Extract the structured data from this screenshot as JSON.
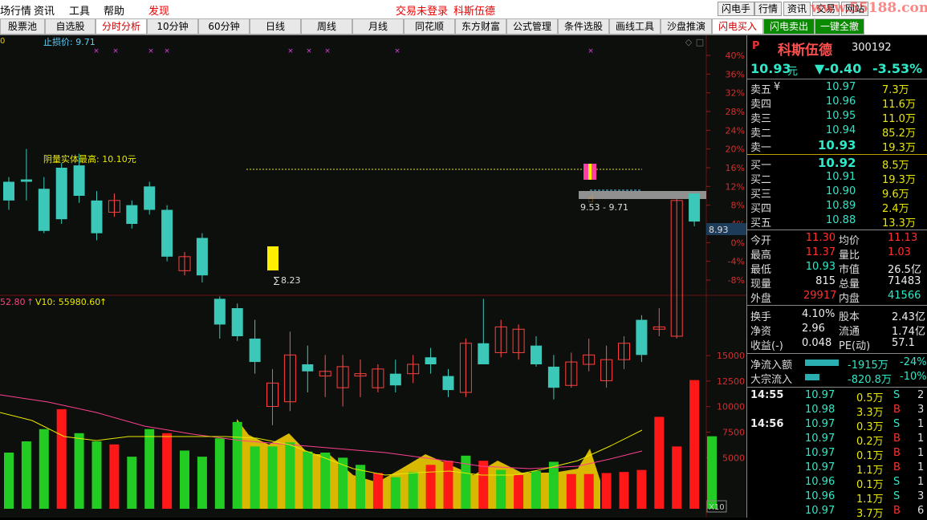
{
  "menu": {
    "items": [
      "场行情",
      "资讯",
      "工具",
      "帮助"
    ],
    "discover": "发现",
    "trade_status": "交易未登录",
    "stock_title": "科斯伍德",
    "right_buttons": [
      "闪电手",
      "行情",
      "资讯",
      "交易",
      "网站"
    ],
    "watermark": "www.55188.com"
  },
  "tabs": [
    {
      "label": "股票池",
      "state": "normal"
    },
    {
      "label": "自选股",
      "state": "normal"
    },
    {
      "label": "分时分析",
      "state": "active"
    },
    {
      "label": "10分钟",
      "state": "normal"
    },
    {
      "label": "60分钟",
      "state": "normal"
    },
    {
      "label": "日线",
      "state": "normal"
    },
    {
      "label": "周线",
      "state": "normal"
    },
    {
      "label": "月线",
      "state": "normal"
    },
    {
      "label": "同花顺",
      "state": "normal"
    },
    {
      "label": "东方财富",
      "state": "normal"
    },
    {
      "label": "公式管理",
      "state": "normal"
    },
    {
      "label": "条件选股",
      "state": "normal"
    },
    {
      "label": "画线工具",
      "state": "normal"
    },
    {
      "label": "沙盘推演",
      "state": "normal"
    },
    {
      "label": "闪电买入",
      "state": "active"
    },
    {
      "label": "闪电卖出",
      "state": "green"
    },
    {
      "label": "一键全撤",
      "state": "green"
    }
  ],
  "chart": {
    "stop_loss_label": "止损价: 9.71",
    "annotation_high": "阴量实体最高: 10.10元",
    "low_label": "8.23",
    "range_label": "9.53 - 9.71",
    "price_tag": "8.93",
    "zero_tag": "0",
    "pct_ticks": [
      "40%",
      "36%",
      "32%",
      "28%",
      "24%",
      "20%",
      "16%",
      "12%",
      "8%",
      "4%",
      "0%",
      "-4%",
      "-8%"
    ],
    "vol_ticks": [
      "15000",
      "12500",
      "10000",
      "7500",
      "5000"
    ],
    "vol_header_prefix": "52.80",
    "vol_header_v10": "V10: 55980.60",
    "x10_label": "X10"
  },
  "chart_data": {
    "type": "candlestick",
    "ylabel": "%",
    "ylim": [
      -10,
      42
    ],
    "candles": [
      {
        "o": 9.0,
        "c": 13.0,
        "h": 14.0,
        "l": 7.0,
        "up": false
      },
      {
        "o": 13.0,
        "c": 13.5,
        "h": 20.0,
        "l": 9.0,
        "up": false
      },
      {
        "o": 11.5,
        "c": 2.5,
        "h": 14.0,
        "l": 2.0,
        "up": false
      },
      {
        "o": 16.0,
        "c": 5.0,
        "h": 17.0,
        "l": 4.0,
        "up": false
      },
      {
        "o": 16.5,
        "c": 10.0,
        "h": 19.0,
        "l": 8.5,
        "up": false
      },
      {
        "o": 9.0,
        "c": 2.0,
        "h": 11.0,
        "l": 0.5,
        "up": false
      },
      {
        "o": 9.0,
        "c": 6.5,
        "h": 10.5,
        "l": 5.5,
        "up": true
      },
      {
        "o": 8.0,
        "c": 4.0,
        "h": 9.0,
        "l": 3.0,
        "up": false
      },
      {
        "o": 12.0,
        "c": 7.0,
        "h": 13.0,
        "l": 6.0,
        "up": false
      },
      {
        "o": 7.0,
        "c": -3.0,
        "h": 8.0,
        "l": -4.0,
        "up": false
      },
      {
        "o": -6.0,
        "c": -3.0,
        "h": -2.0,
        "l": -7.0,
        "up": true
      },
      {
        "o": 1.0,
        "c": -7.0,
        "h": 2.0,
        "l": -8.5,
        "up": false
      },
      {
        "o": -12.0,
        "c": -17.5,
        "h": -11.5,
        "l": -20.5,
        "up": false
      },
      {
        "o": -14.0,
        "c": -20.0,
        "h": -13.0,
        "l": -21.0,
        "up": false
      },
      {
        "o": -25.5,
        "c": -20.5,
        "h": -16.5,
        "l": -28.0,
        "up": false
      },
      {
        "o": -35.0,
        "c": -30.0,
        "h": -27.0,
        "l": -39.0,
        "up": true
      },
      {
        "o": -34.0,
        "c": -24.0,
        "h": -19.0,
        "l": -36.0,
        "up": true
      },
      {
        "o": -26.0,
        "c": -27.5,
        "h": -22.0,
        "l": -32.0,
        "up": false
      },
      {
        "o": -28.5,
        "c": -27.5,
        "h": -24.0,
        "l": -33.0,
        "up": true
      },
      {
        "o": -31.0,
        "c": -26.5,
        "h": -24.0,
        "l": -35.0,
        "up": true
      },
      {
        "o": -28.5,
        "c": -28.0,
        "h": -25.0,
        "l": -33.0,
        "up": true
      },
      {
        "o": -31.0,
        "c": -27.0,
        "h": -26.0,
        "l": -32.0,
        "up": true
      },
      {
        "o": -30.5,
        "c": -28.0,
        "h": -25.0,
        "l": -32.0,
        "up": false
      },
      {
        "o": -28.0,
        "c": -26.0,
        "h": -24.0,
        "l": -30.0,
        "up": true
      },
      {
        "o": -26.0,
        "c": -24.5,
        "h": -22.5,
        "l": -28.0,
        "up": false
      },
      {
        "o": -31.5,
        "c": -28.5,
        "h": -27.0,
        "l": -33.0,
        "up": false
      },
      {
        "o": -32.0,
        "c": -21.5,
        "h": -20.5,
        "l": -33.0,
        "up": true
      },
      {
        "o": -26.0,
        "c": -21.5,
        "h": -12.0,
        "l": -25.5,
        "up": false
      },
      {
        "o": -23.5,
        "c": -18.0,
        "h": -16.5,
        "l": -24.5,
        "up": true
      },
      {
        "o": -23.5,
        "c": -18.5,
        "h": -17.5,
        "l": -25.0,
        "up": true
      },
      {
        "o": -26.0,
        "c": -22.0,
        "h": -20.0,
        "l": -26.5,
        "up": false
      },
      {
        "o": -26.5,
        "c": -31.0,
        "h": -24.0,
        "l": -33.5,
        "up": false
      },
      {
        "o": -30.5,
        "c": -25.5,
        "h": -23.5,
        "l": -31.0,
        "up": true
      },
      {
        "o": -26.0,
        "c": -24.0,
        "h": -20.5,
        "l": -27.5,
        "up": true
      },
      {
        "o": -29.5,
        "c": -25.0,
        "h": -22.0,
        "l": -31.0,
        "up": true
      },
      {
        "o": -25.0,
        "c": -21.5,
        "h": -20.0,
        "l": -27.0,
        "up": true
      },
      {
        "o": -24.0,
        "c": -16.5,
        "h": -15.5,
        "l": -25.5,
        "up": false
      },
      {
        "o": -18.5,
        "c": -18.0,
        "h": -14.0,
        "l": -20.0,
        "up": true
      },
      {
        "o": -20.0,
        "c": 9.0,
        "h": 9.5,
        "l": -20.5,
        "up": true
      },
      {
        "o": 10.5,
        "c": 4.5,
        "h": 10.5,
        "l": 3.5,
        "up": false
      }
    ],
    "volume": {
      "ylim": [
        0,
        16500
      ],
      "values": [
        5500,
        6600,
        7800,
        9750,
        7400,
        6600,
        6300,
        5100,
        7800,
        7400,
        5700,
        5100,
        6900,
        8500,
        6100,
        6100,
        6500,
        5600,
        5500,
        5000,
        4300,
        3500,
        3100,
        3600,
        4300,
        4700,
        5200,
        4700,
        3800,
        3300,
        3700,
        4600,
        3400,
        3400,
        3500,
        3600,
        3800,
        9000,
        6100,
        12600,
        7100
      ],
      "up": [
        false,
        false,
        false,
        true,
        false,
        false,
        true,
        false,
        false,
        true,
        false,
        false,
        false,
        false,
        false,
        false,
        false,
        false,
        false,
        false,
        false,
        true,
        false,
        false,
        true,
        true,
        false,
        true,
        false,
        true,
        false,
        false,
        true,
        true,
        true,
        true,
        true,
        true,
        true,
        true,
        false
      ]
    }
  },
  "panel": {
    "p_label": "P",
    "name": "科斯伍德",
    "code": "300192",
    "price": "10.93",
    "price_unit": "元",
    "change": "▼-0.40",
    "change_pct": "-3.53%",
    "asks": [
      {
        "label": "卖五",
        "price": "10.97",
        "vol": "7.3万"
      },
      {
        "label": "卖四",
        "price": "10.96",
        "vol": "11.6万"
      },
      {
        "label": "卖三",
        "price": "10.95",
        "vol": "11.0万"
      },
      {
        "label": "卖二",
        "price": "10.94",
        "vol": "85.2万"
      },
      {
        "label": "卖一",
        "price": "10.93",
        "vol": "19.3万"
      }
    ],
    "bids": [
      {
        "label": "买一",
        "price": "10.92",
        "vol": "8.5万"
      },
      {
        "label": "买二",
        "price": "10.91",
        "vol": "19.3万"
      },
      {
        "label": "买三",
        "price": "10.90",
        "vol": "9.6万"
      },
      {
        "label": "买四",
        "price": "10.89",
        "vol": "2.4万"
      },
      {
        "label": "买五",
        "price": "10.88",
        "vol": "13.3万"
      }
    ],
    "ask5_marker": "¥",
    "stats": [
      {
        "l1": "今开",
        "v1": "11.30",
        "c1": "up",
        "l2": "均价",
        "v2": "11.13",
        "c2": "up"
      },
      {
        "l1": "最高",
        "v1": "11.37",
        "c1": "up",
        "l2": "量比",
        "v2": "1.03",
        "c2": "up"
      },
      {
        "l1": "最低",
        "v1": "10.93",
        "c1": "dn",
        "l2": "市值",
        "v2": "26.5亿",
        "c2": "wh"
      },
      {
        "l1": "现量",
        "v1": "815",
        "c1": "wh",
        "l2": "总量",
        "v2": "71483",
        "c2": "wh"
      },
      {
        "l1": "外盘",
        "v1": "29917",
        "c1": "up",
        "l2": "内盘",
        "v2": "41566",
        "c2": "dn"
      }
    ],
    "stats2": [
      {
        "l1": "换手",
        "v1": "4.10%",
        "l2": "股本",
        "v2": "2.43亿"
      },
      {
        "l1": "净资",
        "v1": "2.96",
        "l2": "流通",
        "v2": "1.74亿"
      },
      {
        "l1": "收益(-)",
        "v1": "0.048",
        "l2": "PE(动)",
        "v2": "57.1"
      }
    ],
    "flows": [
      {
        "label": "净流入额",
        "value": "-1915万",
        "pct": "-24%"
      },
      {
        "label": "大宗流入",
        "value": "-820.8万",
        "pct": "-10%"
      }
    ],
    "ticks": [
      {
        "time": "14:55",
        "price": "10.97",
        "vol": "0.5万",
        "side": "S",
        "n": "2"
      },
      {
        "time": "",
        "price": "10.98",
        "vol": "3.3万",
        "side": "B",
        "n": "3"
      },
      {
        "time": "14:56",
        "price": "10.97",
        "vol": "0.3万",
        "side": "S",
        "n": "1"
      },
      {
        "time": "",
        "price": "10.97",
        "vol": "0.2万",
        "side": "B",
        "n": "1"
      },
      {
        "time": "",
        "price": "10.97",
        "vol": "0.1万",
        "side": "B",
        "n": "1"
      },
      {
        "time": "",
        "price": "10.97",
        "vol": "1.1万",
        "side": "B",
        "n": "1"
      },
      {
        "time": "",
        "price": "10.96",
        "vol": "0.1万",
        "side": "S",
        "n": "1"
      },
      {
        "time": "",
        "price": "10.96",
        "vol": "1.1万",
        "side": "S",
        "n": "3"
      },
      {
        "time": "",
        "price": "10.97",
        "vol": "3.7万",
        "side": "B",
        "n": "6"
      }
    ]
  }
}
